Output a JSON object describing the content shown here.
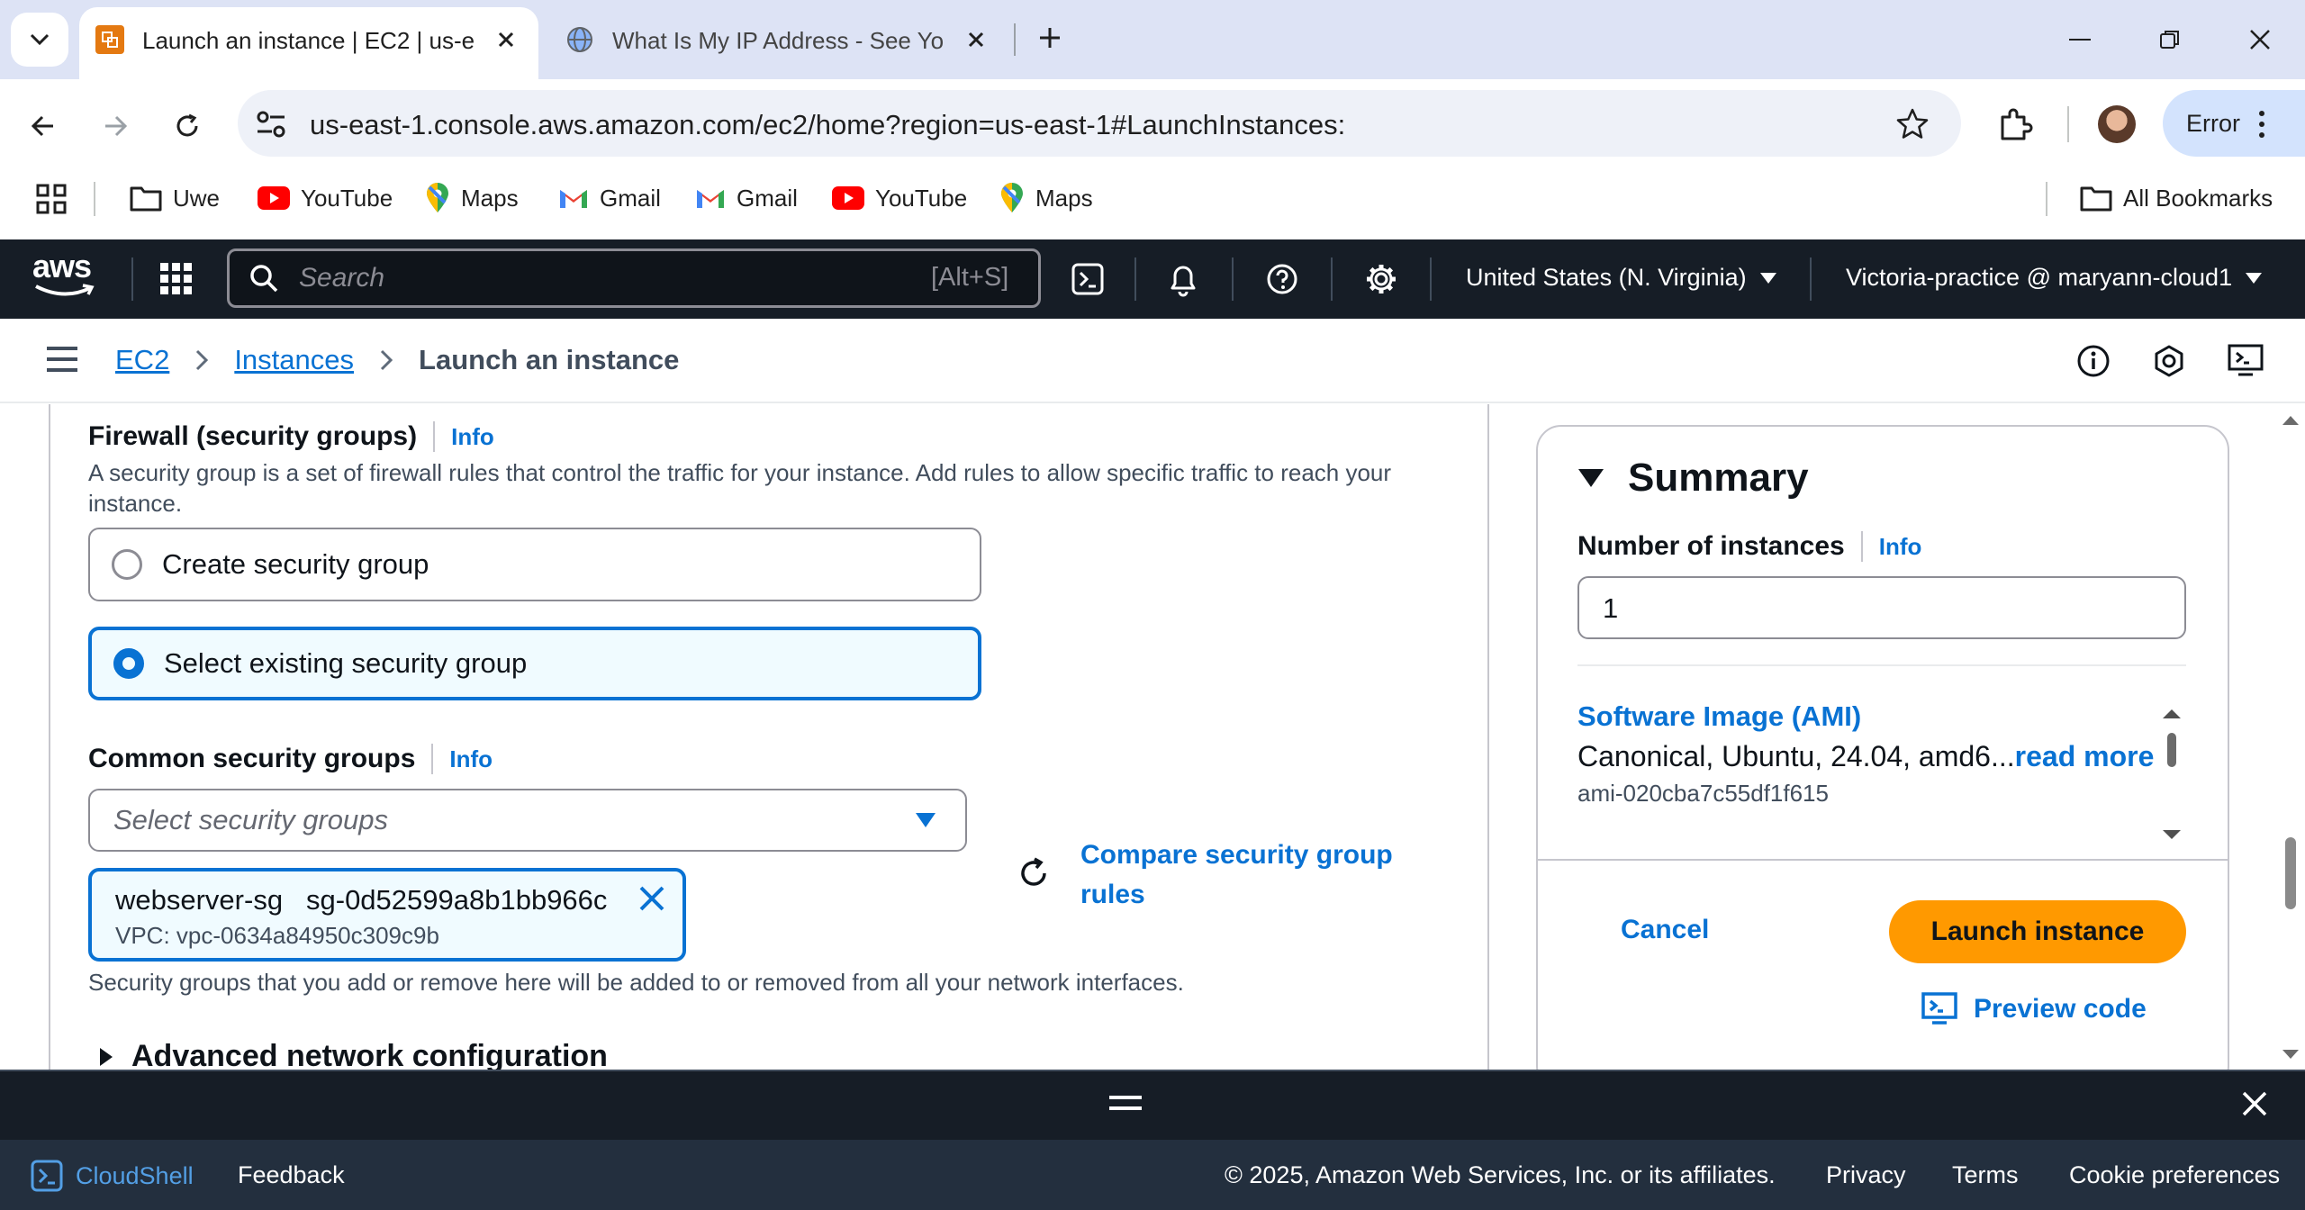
{
  "browser": {
    "tabs": [
      {
        "title": "Launch an instance | EC2 | us-ea",
        "active": true
      },
      {
        "title": "What Is My IP Address - See Yo",
        "active": false
      }
    ],
    "url": "us-east-1.console.aws.amazon.com/ec2/home?region=us-east-1#LaunchInstances:",
    "profile_label": "Error",
    "bookmarks": [
      "Uwe",
      "YouTube",
      "Maps",
      "Gmail",
      "Gmail",
      "YouTube",
      "Maps"
    ],
    "all_bookmarks": "All Bookmarks"
  },
  "aws_nav": {
    "logo": "aws",
    "search_placeholder": "Search",
    "search_shortcut": "[Alt+S]",
    "region": "United States (N. Virginia)",
    "account": "Victoria-practice @ maryann-cloud1"
  },
  "breadcrumb": {
    "items": [
      "EC2",
      "Instances"
    ],
    "current": "Launch an instance"
  },
  "firewall": {
    "title": "Firewall (security groups)",
    "info": "Info",
    "description": "A security group is a set of firewall rules that control the traffic for your instance. Add rules to allow specific traffic to reach your instance.",
    "options": [
      "Create security group",
      "Select existing security group"
    ],
    "selected_option": "Select existing security group",
    "common_title": "Common security groups",
    "common_info": "Info",
    "select_placeholder": "Select security groups",
    "token": {
      "name": "webserver-sg",
      "id": "sg-0d52599a8b1bb966c",
      "vpc": "VPC: vpc-0634a84950c309c9b"
    },
    "compare_link": "Compare security group rules",
    "note": "Security groups that you add or remove here will be added to or removed from all your network interfaces.",
    "advanced": "Advanced network configuration"
  },
  "summary": {
    "title": "Summary",
    "instances_label": "Number of instances",
    "instances_info": "Info",
    "instances_value": "1",
    "ami_title": "Software Image (AMI)",
    "ami_desc": "Canonical, Ubuntu, 24.04, amd6...",
    "read_more": "read more",
    "ami_id": "ami-020cba7c55df1f615",
    "cancel": "Cancel",
    "launch": "Launch instance",
    "preview": "Preview code"
  },
  "footer": {
    "cloudshell": "CloudShell",
    "feedback": "Feedback",
    "copyright": "© 2025, Amazon Web Services, Inc. or its affiliates.",
    "links": [
      "Privacy",
      "Terms",
      "Cookie preferences"
    ]
  },
  "colors": {
    "accent": "#0972d3",
    "primary_button": "#ff9900",
    "nav_bg": "#161d26",
    "footer_bg": "#232f3e"
  }
}
